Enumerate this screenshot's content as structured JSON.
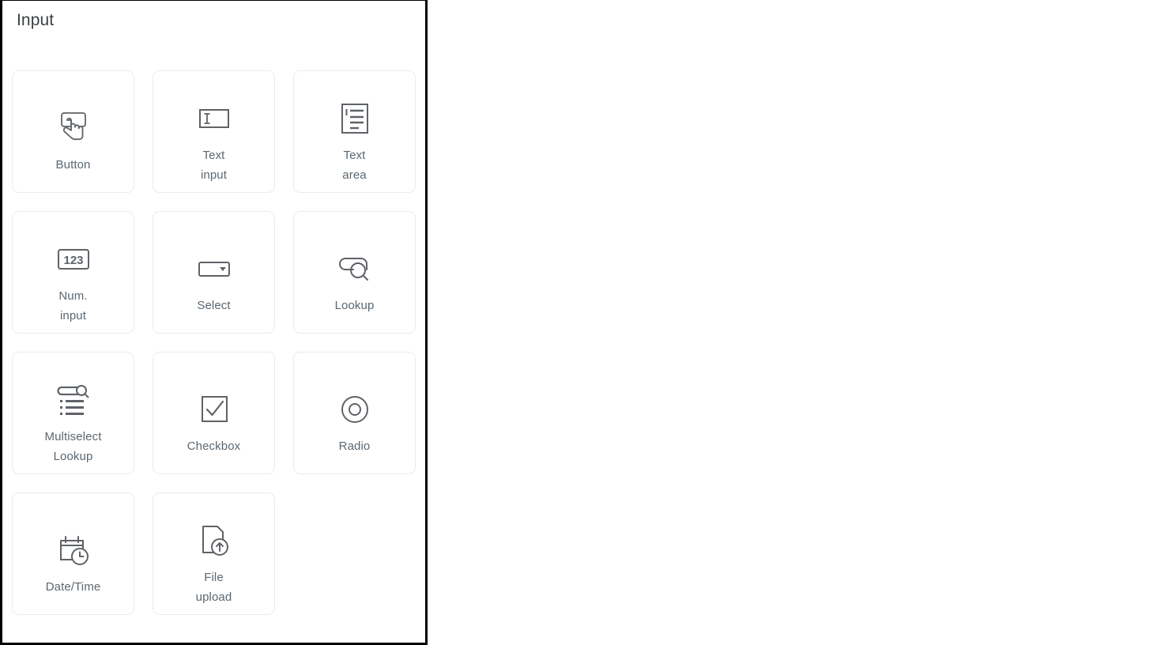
{
  "panel": {
    "title": "Input"
  },
  "cards": [
    {
      "id": "button",
      "label": "Button",
      "icon": "button-icon"
    },
    {
      "id": "text-input",
      "label": "Text\ninput",
      "icon": "text-input-icon"
    },
    {
      "id": "text-area",
      "label": "Text\narea",
      "icon": "text-area-icon"
    },
    {
      "id": "num-input",
      "label": "Num.\ninput",
      "icon": "number-input-icon"
    },
    {
      "id": "select",
      "label": "Select",
      "icon": "select-dropdown-icon"
    },
    {
      "id": "lookup",
      "label": "Lookup",
      "icon": "lookup-search-icon"
    },
    {
      "id": "multiselect-lookup",
      "label": "Multiselect\nLookup",
      "icon": "multiselect-lookup-icon"
    },
    {
      "id": "checkbox",
      "label": "Checkbox",
      "icon": "checkbox-icon"
    },
    {
      "id": "radio",
      "label": "Radio",
      "icon": "radio-button-icon"
    },
    {
      "id": "date-time",
      "label": "Date/Time",
      "icon": "calendar-clock-icon"
    },
    {
      "id": "file-upload",
      "label": "File\nupload",
      "icon": "file-upload-icon"
    }
  ],
  "colors": {
    "panel_border": "#000000",
    "card_border": "#ececec",
    "label_text": "#5b6770",
    "title_text": "#3c4043",
    "icon_stroke": "#5f6368",
    "background": "#ffffff"
  }
}
